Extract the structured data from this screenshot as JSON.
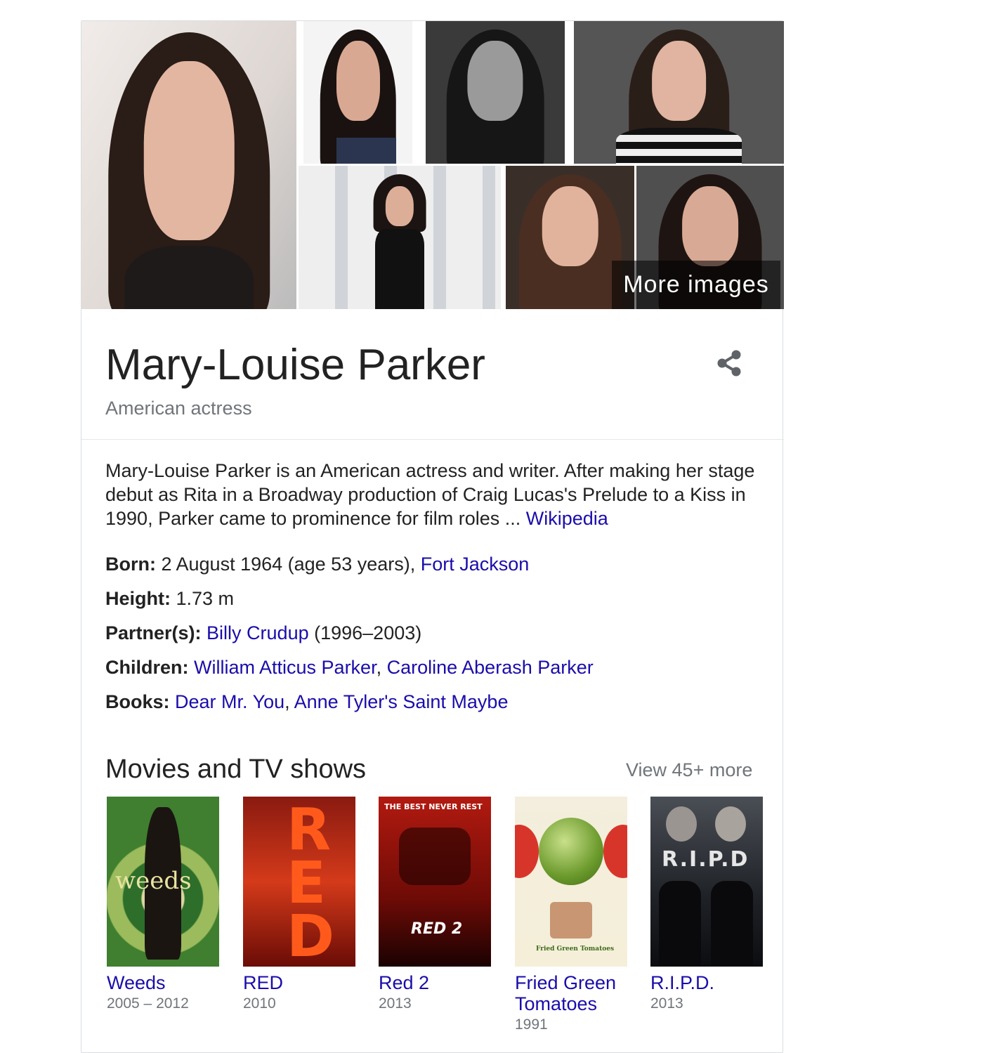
{
  "photos": {
    "more_images_label": "More images"
  },
  "entity": {
    "name": "Mary-Louise Parker",
    "subtitle": "American actress"
  },
  "description": {
    "text": "Mary-Louise Parker is an American actress and writer. After making her stage debut as Rita in a Broadway production of Craig Lucas's Prelude to a Kiss in 1990, Parker came to prominence for film roles ... ",
    "source_link": "Wikipedia"
  },
  "facts": {
    "born": {
      "label": "Born:",
      "text": " 2 August 1964 (age 53 years), ",
      "link": "Fort Jackson"
    },
    "height": {
      "label": "Height:",
      "value": " 1.73 m"
    },
    "partners": {
      "label": "Partner(s):",
      "link": "Billy Crudup",
      "text": " (1996–2003)"
    },
    "children": {
      "label": "Children:",
      "links": [
        "William Atticus Parker",
        "Caroline Aberash Parker"
      ],
      "separator": ", "
    },
    "books": {
      "label": "Books:",
      "links": [
        "Dear Mr. You",
        "Anne Tyler's Saint Maybe"
      ],
      "separator": ", "
    }
  },
  "movies": {
    "title": "Movies and TV shows",
    "view_more": "View 45+ more",
    "items": [
      {
        "title": "Weeds",
        "year": "2005 – 2012",
        "poster_text": "weeds"
      },
      {
        "title": "RED",
        "year": "2010",
        "poster_text": "RED"
      },
      {
        "title": "Red 2",
        "year": "2013",
        "poster_text": "RED 2",
        "poster_tagline": "THE BEST NEVER REST"
      },
      {
        "title": "Fried Green Tomatoes",
        "year": "1991",
        "poster_text": "Fried Green Tomatoes"
      },
      {
        "title": "R.I.P.D.",
        "year": "2013",
        "poster_text": "R.I.P.D"
      }
    ]
  },
  "colors": {
    "link": "#1a0dab",
    "secondary_text": "#70757a",
    "border": "#dadce0"
  }
}
